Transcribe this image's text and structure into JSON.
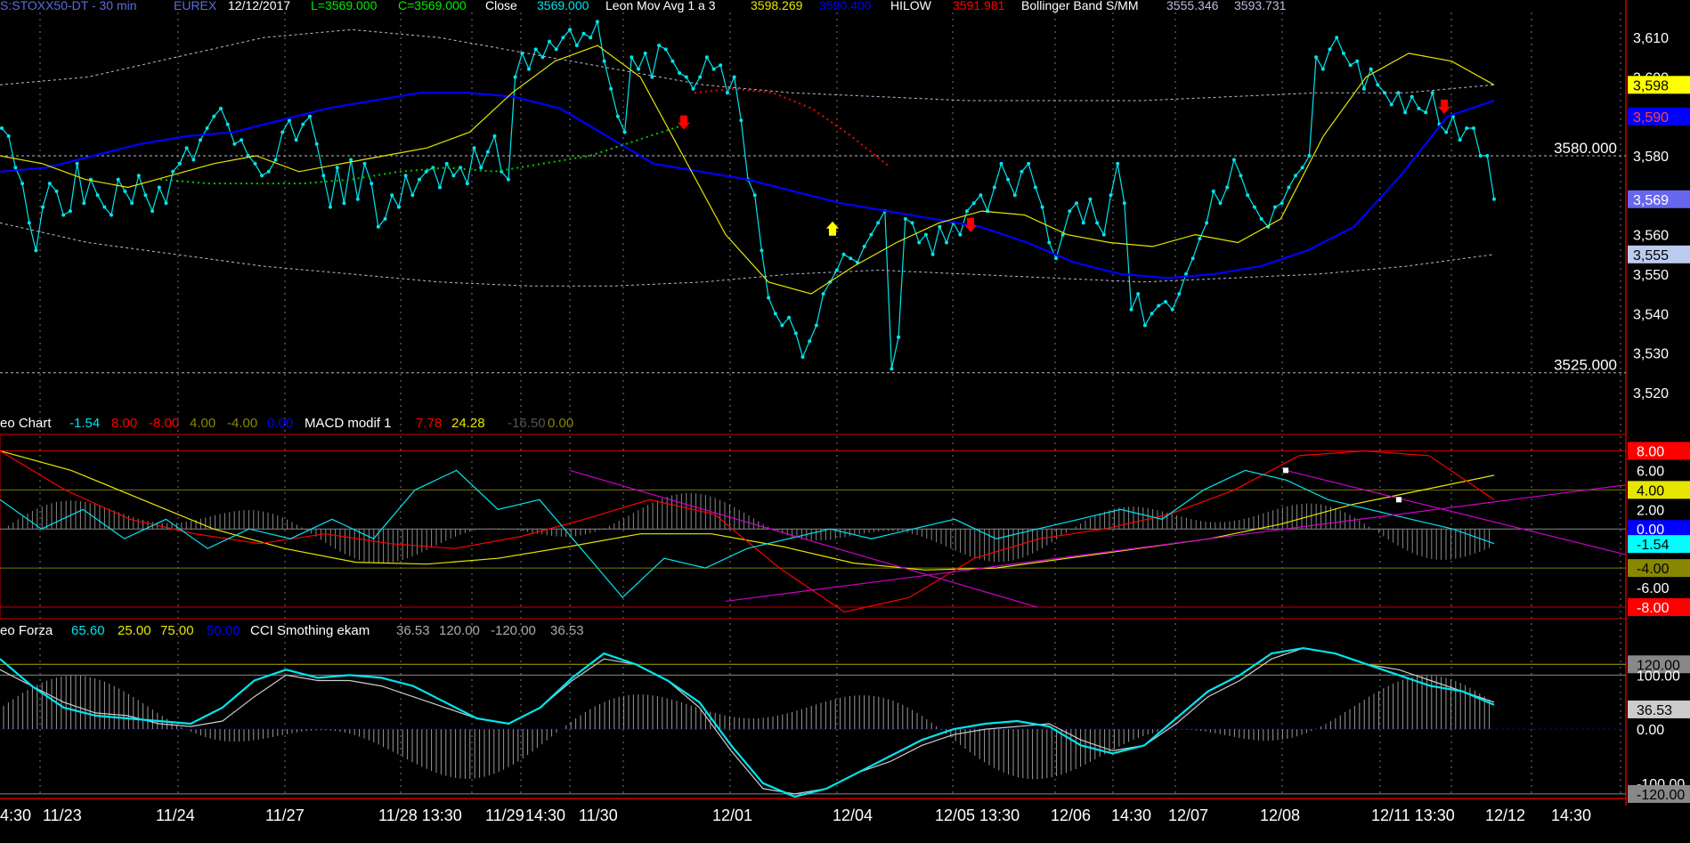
{
  "header": {
    "symbol": "S:STOXX50-DT - 30 min",
    "exchange": "EUREX",
    "date": "12/12/2017",
    "low": "L=3569.000",
    "close_val": "C=3569.000",
    "close_label": "Close",
    "close_num": "3569.000",
    "ma_label": "Leon Mov Avg 1 a 3",
    "ma_v1": "3598.269",
    "ma_v2": "3590.400",
    "hilow_label": "HILOW",
    "hilow_v": "3591.981",
    "bb_label": "Bollinger Band S/MM",
    "bb_v1": "3555.346",
    "bb_v2": "3593.731"
  },
  "macd_header": {
    "name": "eo Chart",
    "v1": "-1.54",
    "v2": "8.00",
    "v3": "-8.00",
    "v4": "4.00",
    "v5": "-4.00",
    "v6": "0.00",
    "label": "MACD modif 1",
    "m1": "7.78",
    "m2": "24.28",
    "m3": "-16.50",
    "m4": "0.00"
  },
  "cci_header": {
    "name": "eo Forza",
    "v1": "65.60",
    "v2": "25.00",
    "v3": "75.00",
    "v4": "50.00",
    "label": "CCI Smothing ekam",
    "c1": "36.53",
    "c2": "120.00",
    "c3": "-120.00",
    "c4": "36.53"
  },
  "colors": {
    "background": "#000000",
    "price": "#00e5ee",
    "ma_blue": "#0000ff",
    "yellow": "#e6e600",
    "red": "#ff0000",
    "green_dots": "#00cc00",
    "magenta": "#cc00cc",
    "grid": "#777777",
    "axis_red": "#cc0000"
  },
  "chart_data": [
    {
      "type": "line",
      "title": "S:STOXX50-DT - 30 min",
      "x_axis_ticks": [
        "4:30",
        "11/23",
        "11/24",
        "11/27",
        "11/28 13:30",
        "11/29",
        "14:30",
        "11/30",
        "12/01",
        "12/04",
        "12/05 13:30",
        "12/06",
        "14:30",
        "12/07",
        "12/08",
        "12/11 13:30",
        "12/12",
        "14:30"
      ],
      "y_axis_ticks": [
        3520,
        3530,
        3540,
        3550,
        3560,
        3570,
        3580,
        3590,
        3600,
        3610
      ],
      "ylim": [
        3515,
        3615
      ],
      "reference_lines": [
        {
          "label": "3580.000",
          "value": 3580
        },
        {
          "label": "3525.000",
          "value": 3525
        }
      ],
      "series": [
        {
          "name": "Close",
          "values": [
            3587,
            3585,
            3577,
            3573,
            3563,
            3556,
            3567,
            3573,
            3571,
            3565,
            3566,
            3578,
            3568,
            3574,
            3570,
            3567,
            3565,
            3574,
            3571,
            3568,
            3575,
            3570,
            3566,
            3572,
            3568,
            3576,
            3578,
            3582,
            3579,
            3584,
            3587,
            3590,
            3592,
            3588,
            3583,
            3584,
            3580,
            3578,
            3575,
            3576,
            3579,
            3586,
            3589,
            3584,
            3588,
            3590,
            3583,
            3575,
            3567,
            3577,
            3568,
            3579,
            3569,
            3578,
            3573,
            3562,
            3564,
            3570,
            3567,
            3575,
            3570,
            3574,
            3576,
            3577,
            3572,
            3578,
            3575,
            3577,
            3573,
            3582,
            3577,
            3581,
            3585,
            3576,
            3574,
            3600,
            3606,
            3602,
            3607,
            3605,
            3609,
            3607,
            3610,
            3612,
            3608,
            3611,
            3610,
            3614,
            3604,
            3597,
            3590,
            3586,
            3605,
            3602,
            3606,
            3600,
            3608,
            3607,
            3604,
            3601,
            3600,
            3597,
            3600,
            3605,
            3602,
            3603,
            3596,
            3600,
            3589,
            3574,
            3570,
            3556,
            3544,
            3540,
            3537,
            3539,
            3535,
            3529,
            3533,
            3537,
            3545,
            3548,
            3551,
            3555,
            3554,
            3553,
            3557,
            3560,
            3563,
            3566,
            3526,
            3534,
            3564,
            3563,
            3558,
            3560,
            3555,
            3562,
            3558,
            3563,
            3560,
            3566,
            3568,
            3570,
            3566,
            3572,
            3578,
            3574,
            3570,
            3576,
            3578,
            3572,
            3567,
            3558,
            3554,
            3560,
            3566,
            3568,
            3563,
            3569,
            3563,
            3560,
            3570,
            3578,
            3568,
            3541,
            3545,
            3537,
            3540,
            3542,
            3543,
            3541,
            3545,
            3550,
            3554,
            3559,
            3563,
            3571,
            3568,
            3572,
            3579,
            3575,
            3570,
            3567,
            3564,
            3562,
            3567,
            3568,
            3572,
            3575,
            3577,
            3580,
            3605,
            3602,
            3607,
            3610,
            3606,
            3603,
            3604,
            3597,
            3602,
            3598,
            3596,
            3593,
            3596,
            3591,
            3595,
            3592,
            3591,
            3596,
            3588,
            3586,
            3590,
            3584,
            3587,
            3587,
            3580,
            3580,
            3569
          ]
        },
        {
          "name": "Leon Mov Avg 1 a 3",
          "values": [
            3576,
            3577,
            3580,
            3583,
            3585,
            3586,
            3589,
            3592,
            3594,
            3596,
            3596,
            3595,
            3592,
            3585,
            3578,
            3576,
            3574,
            3571,
            3568,
            3566,
            3564,
            3562,
            3558,
            3553,
            3550,
            3549,
            3550,
            3552,
            3556,
            3562,
            3575,
            3590,
            3594
          ]
        },
        {
          "name": "Bollinger upper",
          "values": [
            3598,
            3600,
            3605,
            3610,
            3612,
            3610,
            3606,
            3602,
            3598,
            3596,
            3595,
            3594,
            3594,
            3594,
            3595,
            3596,
            3596,
            3598
          ]
        },
        {
          "name": "Bollinger lower",
          "values": [
            3563,
            3558,
            3555,
            3552,
            3550,
            3548,
            3547,
            3547,
            3548,
            3550,
            3551,
            3550,
            3549,
            3548,
            3549,
            3550,
            3552,
            3555
          ]
        }
      ]
    },
    {
      "type": "line",
      "title": "MACD modif 1",
      "y_axis_ticks": [
        -8.0,
        -6.0,
        -4.0,
        -2.0,
        0.0,
        2.0,
        4.0,
        6.0,
        8.0
      ],
      "ylim": [
        -9,
        9.5
      ],
      "value_flags": [
        "8.00",
        "6.00",
        "4.00",
        "2.00",
        "0.00",
        "-1.54",
        "-4.00",
        "-6.00",
        "-8.00"
      ],
      "reference_lines": [
        8,
        4,
        0,
        -4,
        -8
      ]
    },
    {
      "type": "line",
      "title": "CCI Smothing ekam",
      "y_axis_ticks": [
        120.0,
        100.0,
        36.53,
        0.0,
        -100.0,
        -120.0
      ],
      "ylim": [
        -130,
        160
      ],
      "value_flags": [
        "120.00",
        "100.00",
        "36.53",
        "0.00",
        "-100.00",
        "-120.00"
      ],
      "reference_lines": [
        120,
        100,
        0,
        -120
      ]
    }
  ]
}
